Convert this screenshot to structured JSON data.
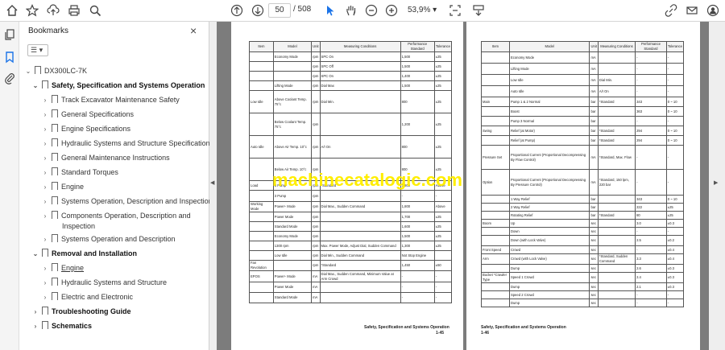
{
  "toolbar": {
    "page_current": "50",
    "page_total": "/ 508",
    "zoom": "53,9%",
    "zoom_arrow": "▾"
  },
  "panel": {
    "title": "Bookmarks",
    "close": "×",
    "menu": "☰ ▾",
    "items": [
      {
        "label": "DX300LC-7K",
        "arrow": "⌄"
      },
      {
        "label": "Safety, Specification and Systems Operation",
        "arrow": "⌄"
      },
      {
        "label": "Track Excavator Maintenance Safety",
        "arrow": "›"
      },
      {
        "label": "General Specifications",
        "arrow": "›"
      },
      {
        "label": "Engine Specifications",
        "arrow": "›"
      },
      {
        "label": "Hydraulic Systems and Structure Specifications",
        "arrow": "›"
      },
      {
        "label": "General Maintenance Instructions",
        "arrow": "›"
      },
      {
        "label": "Standard Torques",
        "arrow": "›"
      },
      {
        "label": "Engine",
        "arrow": "›"
      },
      {
        "label": "Systems Operation, Description and Inspection",
        "arrow": "›"
      },
      {
        "label": "Components Operation, Description and",
        "label2": "Inspection",
        "arrow": "›"
      },
      {
        "label": "Systems Operation and Description",
        "arrow": "›"
      },
      {
        "label": "Removal and Installation",
        "arrow": "⌄"
      },
      {
        "label": "Engine",
        "arrow": "›"
      },
      {
        "label": "Hydraulic Systems and Structure",
        "arrow": "›"
      },
      {
        "label": "Electric and Electronic",
        "arrow": "›"
      },
      {
        "label": "Troubleshooting Guide",
        "arrow": "›"
      },
      {
        "label": "Schematics",
        "arrow": "›"
      }
    ]
  },
  "rails": {
    "left_arrow": "◀",
    "right_arrow": "▶"
  },
  "watermark": "machinecatalogic.com",
  "left_page": {
    "headers": [
      "Item",
      "Model",
      "Unit",
      "Measuring Conditions",
      "Performance Standard",
      "Tolerance"
    ],
    "rows": [
      [
        "",
        "Economy Mode",
        "rpm",
        "SPC On",
        "1,500",
        "±25"
      ],
      [
        "",
        "",
        "rpm",
        "SPC Off",
        "1,500",
        "±25"
      ],
      [
        "",
        "",
        "rpm",
        "SPC On",
        "1,400",
        "±25"
      ],
      [
        "",
        "Lifting Mode",
        "rpm",
        "Dial Max",
        "1,500",
        "±25"
      ],
      [
        "Low Idle",
        "Above Coolant Temp. 75°c",
        "rpm",
        "Dial Min.",
        "800",
        "±25"
      ],
      [
        "",
        "Below Coolant Temp. 75°c",
        "rpm",
        "",
        "1,200",
        "±25"
      ],
      [
        "Auto Idle",
        "Above Air Temp. 10°c",
        "rpm",
        "A/I On",
        "800",
        "±25"
      ],
      [
        "",
        "Below Air Temp. 10°c",
        "rpm",
        "",
        "800",
        "±25"
      ],
      [
        "Load",
        "8 Pump",
        "rpm",
        "*Standard",
        "1,800",
        "Above"
      ],
      [
        "",
        "3 Pump",
        "rpm",
        "",
        "-",
        "-"
      ],
      [
        "Working Mode",
        "Power+ Mode",
        "rpm",
        "Dial Max., Sudden Command",
        "1,800",
        "Above"
      ],
      [
        "",
        "Power Mode",
        "rpm",
        "",
        "1,700",
        "±25"
      ],
      [
        "",
        "Standard Mode",
        "rpm",
        "",
        "1,600",
        "±25"
      ],
      [
        "",
        "Economy Mode",
        "rpm",
        "",
        "1,500",
        "±25"
      ],
      [
        "",
        "1300 rpm",
        "rpm",
        "Max. Power Mode, Adjust Dial, Sudden Command",
        "1,300",
        "±25"
      ],
      [
        "",
        "Low Idle",
        "rpm",
        "Dial Min., Sudden Command",
        "Not Stop Engine",
        ""
      ],
      [
        "Fan Revolution",
        "",
        "rpm",
        "*Standard",
        "1,450",
        "±50"
      ],
      [
        "EPOS",
        "Power+ Mode",
        "mA",
        "Dial Max., Sudden Command, Minimum Value at Arm Crowd",
        "-",
        "-"
      ],
      [
        "",
        "Power Mode",
        "mA",
        "",
        "-",
        "-"
      ],
      [
        "",
        "Standard Mode",
        "mA",
        "",
        "-",
        "-"
      ]
    ],
    "footer": "Safety, Specification and Systems Operation",
    "page_no": "1-45"
  },
  "right_page": {
    "headers": [
      "Item",
      "Model",
      "Unit",
      "Measuring Conditions",
      "Performance Standard",
      "Tolerance"
    ],
    "rows": [
      [
        "",
        "Economy Mode",
        "mA",
        "",
        "-",
        "-"
      ],
      [
        "",
        "Lifting Mode",
        "mA",
        "",
        "-",
        "-"
      ],
      [
        "",
        "Low Idle",
        "mA",
        "Dial Min.",
        "-",
        "-"
      ],
      [
        "",
        "Auto Idle",
        "mA",
        "A/I On",
        "-",
        "-"
      ],
      [
        "Main",
        "Pump 1 & 2 Normal",
        "bar",
        "*Standard",
        "343",
        "0 ~ 10"
      ],
      [
        "",
        "Boost",
        "bar",
        "",
        "363",
        "0 ~ 10"
      ],
      [
        "",
        "Pump 3 Normal",
        "bar",
        "",
        "-",
        "-"
      ],
      [
        "Swing",
        "Relief (at Motor)",
        "bar",
        "*Standard",
        "294",
        "0 ~ 10"
      ],
      [
        "",
        "Relief (at Pump)",
        "bar",
        "*Standard",
        "294",
        "0 ~ 10"
      ],
      [
        "Pressure Set",
        "Proportional Current (Proportional Decompressing By Flow Control)",
        "mA",
        "*Standard, Max. Flow",
        "-",
        "-"
      ],
      [
        "Option",
        "Proportional Current (Proportional Decompressing By Pressure Control)",
        "mA",
        "*Standard, 150 lpm, 220 bar",
        "-",
        "-"
      ],
      [
        "",
        "1 Way Relief",
        "bar",
        "",
        "343",
        "0 ~ 10"
      ],
      [
        "",
        "2 Way Relief",
        "bar",
        "",
        "222",
        "±25"
      ],
      [
        "",
        "Rotating Relief",
        "bar",
        "*Standard",
        "80",
        "±25"
      ],
      [
        "Boom",
        "Up",
        "sec",
        "",
        "3.0",
        "±0.3"
      ],
      [
        "",
        "Down",
        "sec",
        "",
        "-",
        "-"
      ],
      [
        "",
        "Down (with Lock Valve)",
        "sec",
        "",
        "2.5",
        "±0.2"
      ],
      [
        "Front Speed",
        "Crowd",
        "sec",
        "",
        "-",
        "±0.4"
      ],
      [
        "Arm",
        "Crowd (with Lock Valve)",
        "sec",
        "*Standard, Sudden Command",
        "3.3",
        "±0.4"
      ],
      [
        "",
        "Dump",
        "sec",
        "",
        "2.6",
        "±0.3"
      ],
      [
        "Bucket *Crawler Type",
        "Speed 1 Crowd",
        "sec",
        "",
        "2.4",
        "±0.3"
      ],
      [
        "",
        "Dump",
        "sec",
        "",
        "2.1",
        "±0.3"
      ],
      [
        "",
        "Speed 2 Crowd",
        "sec",
        "",
        "-",
        "-"
      ],
      [
        "",
        "Dump",
        "sec",
        "",
        "-",
        "-"
      ]
    ],
    "footer": "Safety, Specification and Systems Operation",
    "page_no": "1-46"
  },
  "colors": {
    "doc_bg": "#7c7c7c",
    "accent_blue": "#1a73e8",
    "watermark": "#ffee00"
  },
  "icons": [
    "star-icon",
    "upload-icon",
    "print-icon",
    "search-zoom-icon",
    "page-up-icon",
    "page-down-icon",
    "cursor-icon",
    "hand-icon",
    "zoom-out-icon",
    "zoom-in-icon",
    "fit-icon",
    "scroll-mode-icon",
    "link-icon",
    "mail-icon",
    "account-icon",
    "home-icon",
    "copy-icon",
    "bookmark-icon",
    "attachment-icon"
  ]
}
